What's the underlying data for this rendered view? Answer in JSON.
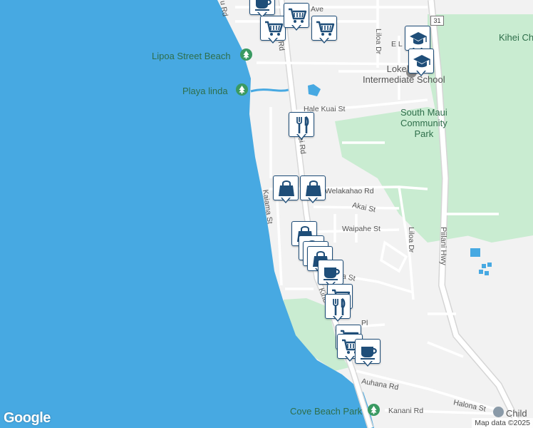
{
  "map": {
    "colors": {
      "water": "#47a9e2",
      "land": "#f2f2f2",
      "park": "#c9ecd1",
      "road": "#ffffff",
      "road_outline": "#d5d5d5",
      "highway": "#dddddd",
      "marker_border": "#1f4e79",
      "marker_icon": "#1f4e79"
    },
    "poi_labels": {
      "lipoa_beach": "Lipoa Street Beach",
      "playa_linda": "Playa linda",
      "cove_beach_park": "Cove Beach Park",
      "lokelani_1": "Lokelani",
      "lokelani_2": "Intermediate School",
      "community_1": "South Maui",
      "community_2": "Community",
      "community_3": "Park",
      "kihei_ch": "Kihei Ch",
      "child": "Child"
    },
    "road_labels": {
      "u_rd": "u Rd",
      "kihei_rd_top": "ei Rd",
      "kihei_rd_mid": "hei Rd",
      "liloa_dr_top": "Liloa Dr",
      "e_l": "E L",
      "hale_kuai": "Hale Kuai St",
      "welakahao": "E Welakahao Rd",
      "kaiama": "Kaiama St",
      "akai": "Akai St",
      "waipahe": "Waipahe St",
      "liloa_dr_mid": "Liloa Dr",
      "piilani": "Piilani Hwy",
      "a_st": "a St",
      "kihei_low": "Kihe",
      "pl": "Pl",
      "auhana": "Auhana Rd",
      "kanani": "Kanani Rd",
      "halona": "Halona St",
      "ave": "Ave"
    },
    "route_shield": "31",
    "markers": [
      {
        "id": "coffee-1",
        "icon": "coffee-icon"
      },
      {
        "id": "cart-1",
        "icon": "cart-icon"
      },
      {
        "id": "cart-2",
        "icon": "cart-icon"
      },
      {
        "id": "cart-3",
        "icon": "cart-icon"
      },
      {
        "id": "school-1",
        "icon": "school-icon"
      },
      {
        "id": "school-2",
        "icon": "school-icon"
      },
      {
        "id": "dining-1",
        "icon": "dining-icon"
      },
      {
        "id": "shop-1",
        "icon": "shopping-bag-icon"
      },
      {
        "id": "shop-2",
        "icon": "shopping-bag-icon"
      },
      {
        "id": "shop-3",
        "icon": "shopping-bag-icon"
      },
      {
        "id": "stack-1",
        "icon": "shopping-bag-icon"
      },
      {
        "id": "stack-2",
        "icon": "shopping-bag-icon"
      },
      {
        "id": "stack-3",
        "icon": "shopping-bag-icon"
      },
      {
        "id": "coffee-2",
        "icon": "coffee-icon"
      },
      {
        "id": "cart-4",
        "icon": "cart-icon"
      },
      {
        "id": "dining-2",
        "icon": "dining-icon"
      },
      {
        "id": "cart-5",
        "icon": "cart-icon"
      },
      {
        "id": "cart-6",
        "icon": "cart-icon"
      },
      {
        "id": "coffee-3",
        "icon": "coffee-icon"
      }
    ],
    "logo": "Google",
    "attribution": "Map data ©2025"
  }
}
